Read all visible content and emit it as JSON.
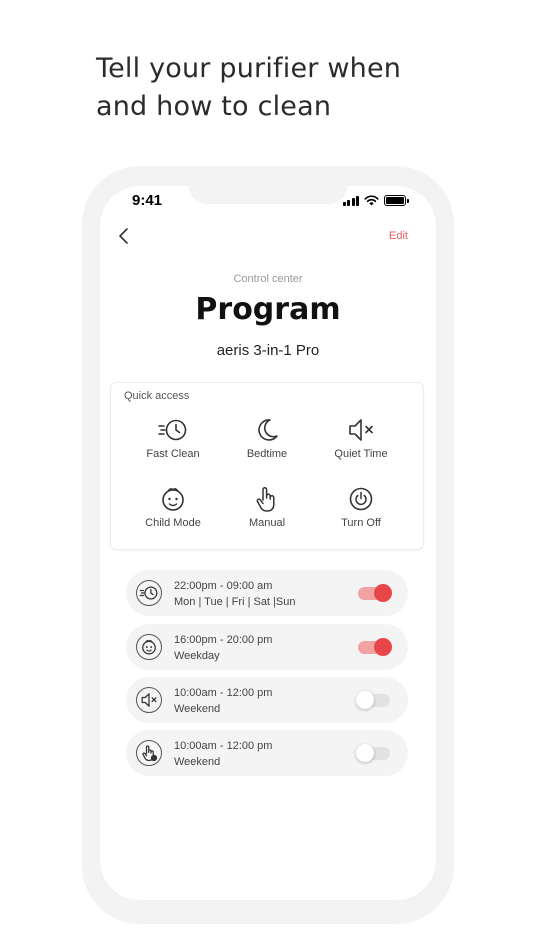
{
  "headline": {
    "line1": "Tell your purifier when",
    "line2": "and how to clean"
  },
  "status_bar": {
    "time": "9:41"
  },
  "header": {
    "edit_label": "Edit"
  },
  "subtitle": "Control center",
  "title": "Program",
  "device": "aeris 3-in-1 Pro",
  "quick_access": {
    "label": "Quick access",
    "items": [
      {
        "label": "Fast Clean",
        "icon": "fast-clean-icon"
      },
      {
        "label": "Bedtime",
        "icon": "moon-icon"
      },
      {
        "label": "Quiet Time",
        "icon": "mute-icon"
      },
      {
        "label": "Child Mode",
        "icon": "child-face-icon"
      },
      {
        "label": "Manual",
        "icon": "hand-icon"
      },
      {
        "label": "Turn Off",
        "icon": "power-icon"
      }
    ]
  },
  "schedules": [
    {
      "time": "22:00pm - 09:00 am",
      "days": "Mon | Tue | Fri | Sat |Sun",
      "icon": "fast-clean-icon",
      "enabled": true
    },
    {
      "time": "16:00pm - 20:00 pm",
      "days": "Weekday",
      "icon": "child-face-icon",
      "enabled": true
    },
    {
      "time": "10:00am - 12:00 pm",
      "days": "Weekend",
      "icon": "mute-icon",
      "enabled": false
    },
    {
      "time": "10:00am - 12:00 pm",
      "days": "Weekend",
      "icon": "hand-icon",
      "enabled": false
    }
  ],
  "colors": {
    "accent": "#e8474a",
    "edit": "#e6605f",
    "frame": "#f3f3f3"
  }
}
